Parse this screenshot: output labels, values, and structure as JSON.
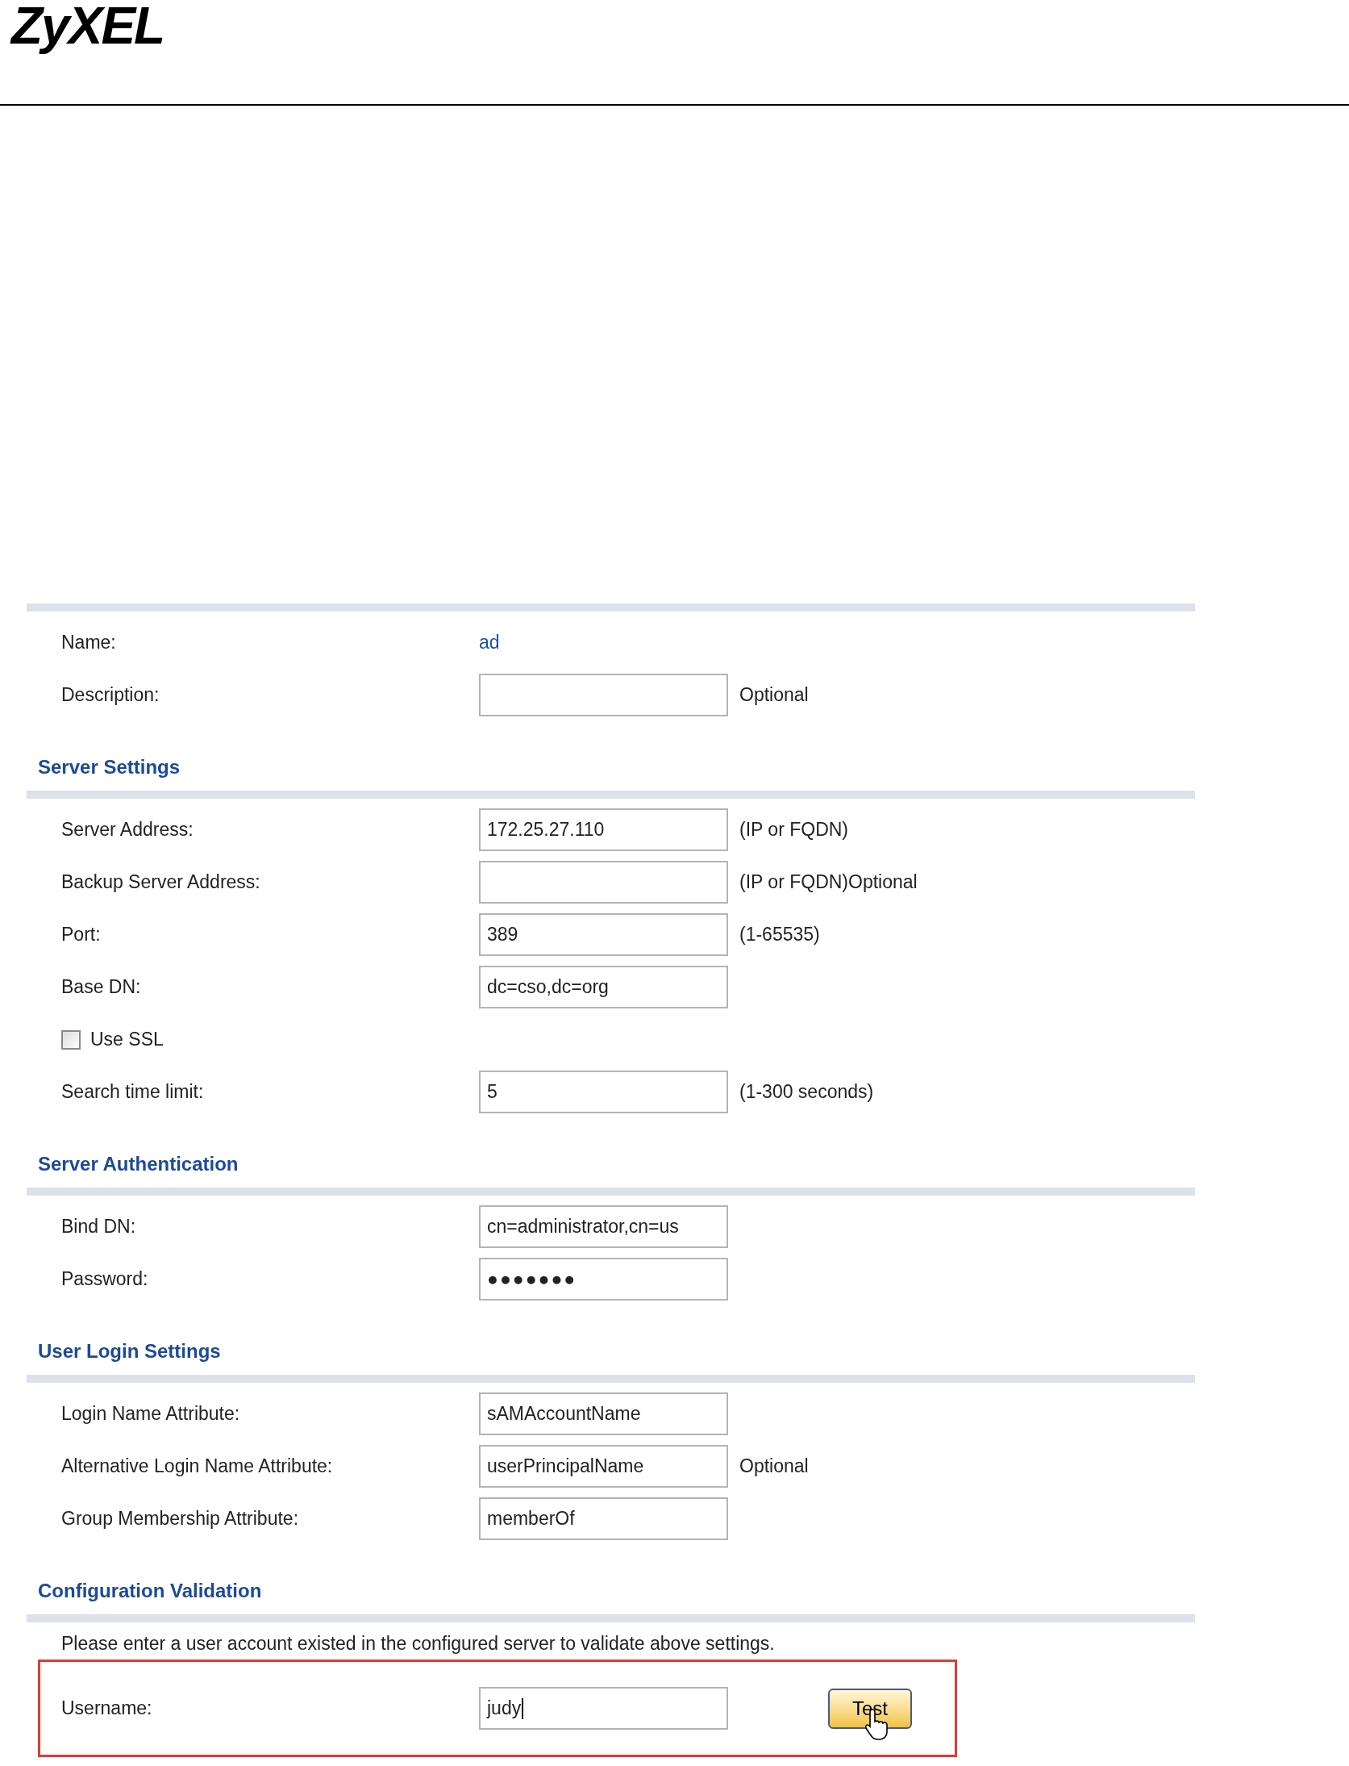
{
  "logo": {
    "text": "ZyXEL"
  },
  "sections": [
    {
      "rows": [
        {
          "kind": "text",
          "label": "Name:",
          "value": "ad"
        },
        {
          "kind": "input",
          "label": "Description:",
          "hint": "Optional"
        }
      ]
    },
    {
      "title": "Server Settings",
      "rows": [
        {
          "kind": "input",
          "label": "Server Address:",
          "value": "172.25.27.110",
          "hint": "(IP or FQDN)"
        },
        {
          "kind": "input",
          "label": "Backup Server Address:",
          "hint": "(IP or FQDN)Optional"
        },
        {
          "kind": "input",
          "label": "Port:",
          "value": "389",
          "hint": "(1-65535)"
        },
        {
          "kind": "input",
          "label": "Base DN:",
          "value": "dc=cso,dc=org"
        },
        {
          "kind": "checkbox",
          "label": "Use SSL",
          "checked": false
        },
        {
          "kind": "input",
          "label": "Search time limit:",
          "value": "5",
          "hint": "(1-300 seconds)"
        }
      ]
    },
    {
      "title": "Server Authentication",
      "rows": [
        {
          "kind": "input",
          "label": "Bind DN:",
          "value": "cn=administrator,cn=us"
        },
        {
          "kind": "password",
          "label": "Password:",
          "value": "●●●●●●●"
        }
      ]
    },
    {
      "title": "User Login Settings",
      "rows": [
        {
          "kind": "input",
          "label": "Login Name Attribute:",
          "value": "sAMAccountName"
        },
        {
          "kind": "input",
          "label": "Alternative Login Name Attribute:",
          "value": "userPrincipalName",
          "hint": "Optional"
        },
        {
          "kind": "input",
          "label": "Group Membership Attribute:",
          "value": "memberOf"
        }
      ]
    },
    {
      "title": "Configuration Validation",
      "rows": [
        {
          "kind": "note",
          "text": "Please enter a user account existed in the configured server to validate above settings."
        },
        {
          "kind": "input",
          "label": "Username:",
          "value": "judy",
          "focused": true,
          "button": "Test",
          "highlighted": true
        }
      ]
    }
  ]
}
